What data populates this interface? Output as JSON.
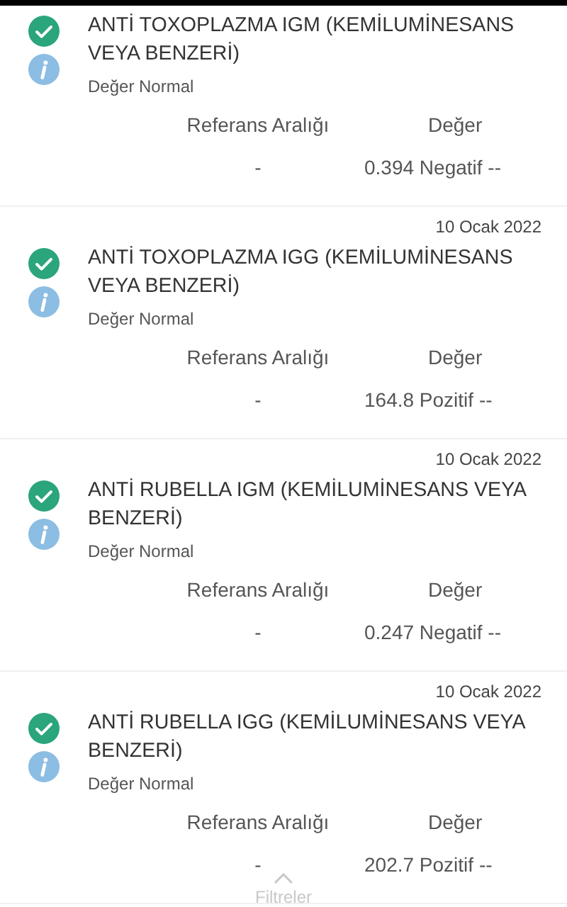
{
  "results": [
    {
      "title": "ANTİ TOXOPLAZMA IGM (KEMİLUMİNESANS VEYA BENZERİ)",
      "status": "Değer Normal",
      "reference_header": "Referans Aralığı",
      "value_header": "Değer",
      "reference": "-",
      "value": "0.394 Negatif --"
    },
    {
      "date": "10 Ocak 2022",
      "title": "ANTİ TOXOPLAZMA IGG (KEMİLUMİNESANS VEYA BENZERİ)",
      "status": "Değer Normal",
      "reference_header": "Referans Aralığı",
      "value_header": "Değer",
      "reference": "-",
      "value": "164.8 Pozitif --"
    },
    {
      "date": "10 Ocak 2022",
      "title": "ANTİ RUBELLA IGM (KEMİLUMİNESANS VEYA BENZERİ)",
      "status": "Değer Normal",
      "reference_header": "Referans Aralığı",
      "value_header": "Değer",
      "reference": "-",
      "value": "0.247 Negatif --"
    },
    {
      "date": "10 Ocak 2022",
      "title": "ANTİ RUBELLA IGG (KEMİLUMİNESANS VEYA BENZERİ)",
      "status": "Değer Normal",
      "reference_header": "Referans Aralığı",
      "value_header": "Değer",
      "reference": "-",
      "value": "202.7 Pozitif --"
    }
  ],
  "filter_button": {
    "label": "Filtreler"
  }
}
